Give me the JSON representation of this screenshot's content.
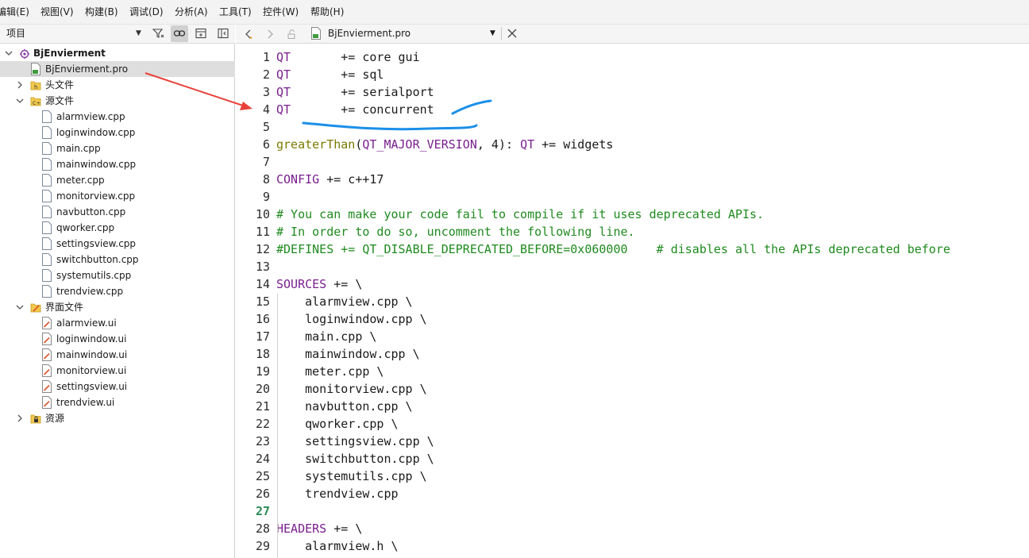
{
  "menu": [
    "编辑(E)",
    "视图(V)",
    "构建(B)",
    "调试(D)",
    "分析(A)",
    "工具(T)",
    "控件(W)",
    "帮助(H)"
  ],
  "left_panel": {
    "selector_label": "项目",
    "tree": {
      "project": "BjEnvierment",
      "pro_file": "BjEnvierment.pro",
      "headers_label": "头文件",
      "sources_label": "源文件",
      "sources": [
        "alarmview.cpp",
        "loginwindow.cpp",
        "main.cpp",
        "mainwindow.cpp",
        "meter.cpp",
        "monitorview.cpp",
        "navbutton.cpp",
        "qworker.cpp",
        "settingsview.cpp",
        "switchbutton.cpp",
        "systemutils.cpp",
        "trendview.cpp"
      ],
      "forms_label": "界面文件",
      "forms": [
        "alarmview.ui",
        "loginwindow.ui",
        "mainwindow.ui",
        "monitorview.ui",
        "settingsview.ui",
        "trendview.ui"
      ],
      "resources_label": "资源"
    }
  },
  "editor": {
    "document": "BjEnvierment.pro",
    "current_line": 27,
    "lines": [
      "QT       += core gui",
      "QT       += sql",
      "QT       += serialport",
      "QT       += concurrent",
      "",
      "greaterThan(QT_MAJOR_VERSION, 4): QT += widgets",
      "",
      "CONFIG += c++17",
      "",
      "# You can make your code fail to compile if it uses deprecated APIs.",
      "# In order to do so, uncomment the following line.",
      "#DEFINES += QT_DISABLE_DEPRECATED_BEFORE=0x060000    # disables all the APIs deprecated before",
      "",
      "SOURCES += \\",
      "    alarmview.cpp \\",
      "    loginwindow.cpp \\",
      "    main.cpp \\",
      "    mainwindow.cpp \\",
      "    meter.cpp \\",
      "    monitorview.cpp \\",
      "    navbutton.cpp \\",
      "    qworker.cpp \\",
      "    settingsview.cpp \\",
      "    switchbutton.cpp \\",
      "    systemutils.cpp \\",
      "    trendview.cpp",
      "",
      "HEADERS += \\",
      "    alarmview.h \\"
    ]
  },
  "colors": {
    "keyword": "#7a1f8f",
    "function": "#7a7a00",
    "comment": "#1f8a1f",
    "current_line_number": "#2e8b57",
    "annotation_arrow": "#e8423a",
    "annotation_underline": "#1a8fe8"
  }
}
